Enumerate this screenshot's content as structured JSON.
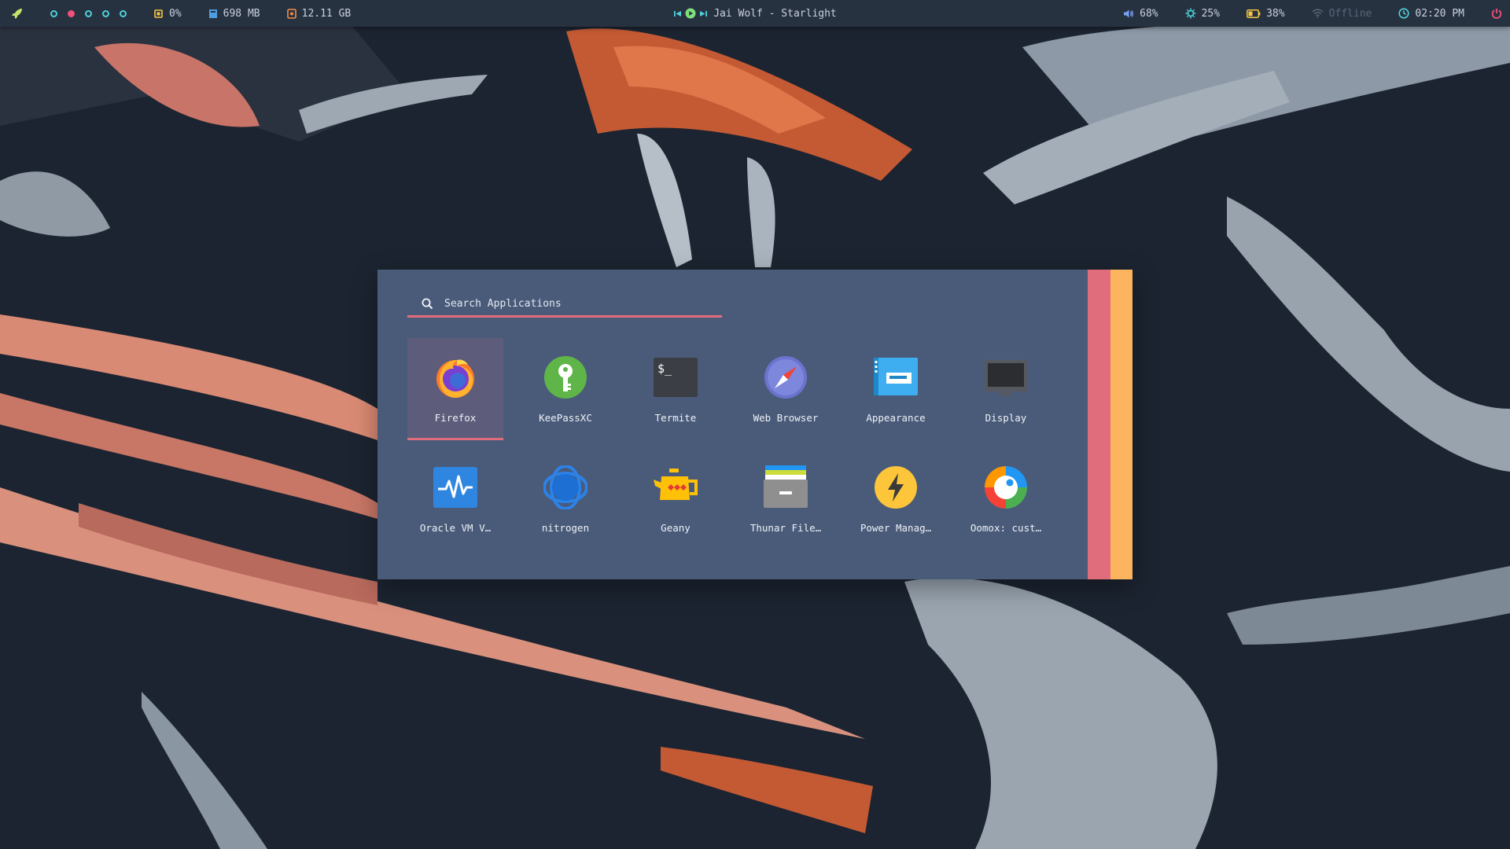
{
  "topbar": {
    "launcher_icon": "rocket-icon",
    "workspaces": [
      {
        "name": "workspace-1",
        "active": false
      },
      {
        "name": "workspace-2",
        "active": true
      },
      {
        "name": "workspace-3",
        "active": false
      },
      {
        "name": "workspace-4",
        "active": false
      },
      {
        "name": "workspace-5",
        "active": false
      }
    ],
    "cpu": "0%",
    "memory": "698 MB",
    "disk": "12.11 GB",
    "player": {
      "track": "Jai Wolf - Starlight"
    },
    "volume": "68%",
    "brightness": "25%",
    "battery": "38%",
    "network": "Offline",
    "clock": "02:20 PM"
  },
  "launcher": {
    "search_placeholder": "Search Applications",
    "apps": [
      {
        "label": "Firefox",
        "icon": "firefox-icon",
        "selected": true
      },
      {
        "label": "KeePassXC",
        "icon": "keepassxc-icon"
      },
      {
        "label": "Termite",
        "icon": "terminal-icon"
      },
      {
        "label": "Web Browser",
        "icon": "compass-icon"
      },
      {
        "label": "Appearance",
        "icon": "appearance-icon"
      },
      {
        "label": "Display",
        "icon": "monitor-icon"
      },
      {
        "label": "Oracle VM V…",
        "icon": "virtualbox-icon"
      },
      {
        "label": "nitrogen",
        "icon": "nitrogen-icon"
      },
      {
        "label": "Geany",
        "icon": "teapot-icon"
      },
      {
        "label": "Thunar File…",
        "icon": "file-manager-icon"
      },
      {
        "label": "Power Manag…",
        "icon": "lightning-icon"
      },
      {
        "label": "Oomox: cust…",
        "icon": "oomox-icon"
      }
    ]
  },
  "colors": {
    "bar_bg": "#273241",
    "accent_cyan": "#4fd1d9",
    "accent_pink": "#f2507b",
    "launcher_bg": "#4a5b7a",
    "stripe_red": "#e06d7c",
    "stripe_orange": "#fcb45f"
  }
}
